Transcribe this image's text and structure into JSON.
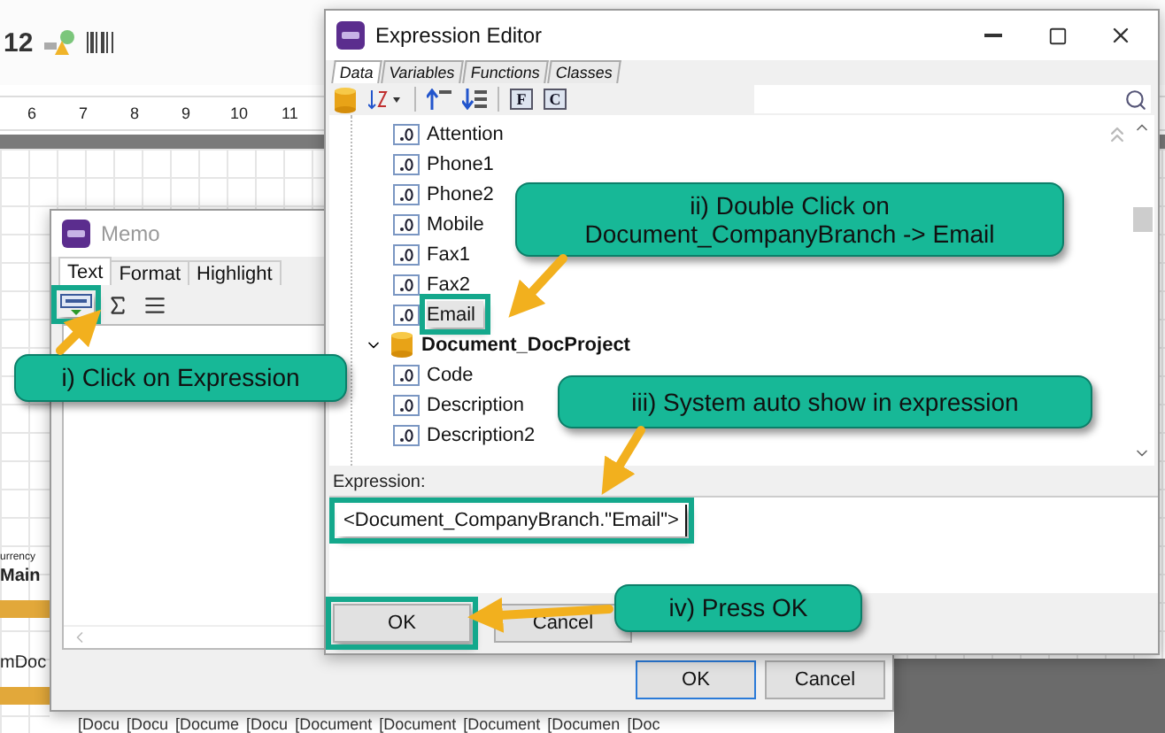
{
  "background": {
    "toolbar_text": "12",
    "ruler": [
      "6",
      "7",
      "8",
      "9",
      "10",
      "11"
    ],
    "side_labels": [
      {
        "text": "urrency",
        "kind": "caption"
      },
      {
        "text": "Main",
        "kind": "heading"
      },
      {
        "text": "mDoc",
        "kind": "field"
      }
    ],
    "field_strip": [
      "[Docu",
      "[Docu",
      "[Docume",
      "[Docu",
      "[Document",
      "[Document",
      "[Document",
      "[Documen",
      "[Doc"
    ]
  },
  "memo": {
    "title": "Memo",
    "tabs": [
      {
        "label": "Text",
        "selected": true
      },
      {
        "label": "Format",
        "selected": false
      },
      {
        "label": "Highlight",
        "selected": false
      }
    ],
    "toolbar": [
      {
        "kind": "expression",
        "highlighted": true
      },
      {
        "kind": "sum",
        "highlighted": false
      },
      {
        "kind": "align",
        "highlighted": false
      }
    ],
    "buttons": [
      {
        "label": "OK",
        "default": true
      },
      {
        "label": "Cancel",
        "default": false
      }
    ]
  },
  "editor": {
    "title": "Expression Editor",
    "tabs": [
      {
        "label": "Data",
        "selected": true
      },
      {
        "label": "Variables",
        "selected": false
      },
      {
        "label": "Functions",
        "selected": false
      },
      {
        "label": "Classes",
        "selected": false
      }
    ],
    "toolbar_buttons": [
      "F",
      "C"
    ],
    "tree": [
      {
        "label": "Attention",
        "kind": "field",
        "selected": false,
        "highlighted": false
      },
      {
        "label": "Phone1",
        "kind": "field",
        "selected": false,
        "highlighted": false
      },
      {
        "label": "Phone2",
        "kind": "field",
        "selected": false,
        "highlighted": false
      },
      {
        "label": "Mobile",
        "kind": "field",
        "selected": false,
        "highlighted": false
      },
      {
        "label": "Fax1",
        "kind": "field",
        "selected": false,
        "highlighted": false
      },
      {
        "label": "Fax2",
        "kind": "field",
        "selected": false,
        "highlighted": false
      },
      {
        "label": "Email",
        "kind": "field",
        "selected": true,
        "highlighted": true
      },
      {
        "label": "Document_DocProject",
        "kind": "table",
        "selected": false,
        "highlighted": false,
        "expanded": true,
        "children": [
          {
            "label": "Code",
            "kind": "field",
            "selected": false,
            "highlighted": false
          },
          {
            "label": "Description",
            "kind": "field",
            "selected": false,
            "highlighted": false
          },
          {
            "label": "Description2",
            "kind": "field",
            "selected": false,
            "highlighted": false
          }
        ]
      }
    ],
    "expression": {
      "label": "Expression:",
      "value": "<Document_CompanyBranch.\"Email\">",
      "highlighted": true
    },
    "buttons": [
      {
        "label": "OK",
        "highlighted": true
      },
      {
        "label": "Cancel",
        "highlighted": false
      }
    ]
  },
  "callouts": [
    {
      "text": "i) Click on Expression"
    },
    {
      "text": "ii) Double Click on\nDocument_CompanyBranch -> Email"
    },
    {
      "text": "iii) System auto show in expression"
    },
    {
      "text": "iv) Press OK"
    }
  ]
}
